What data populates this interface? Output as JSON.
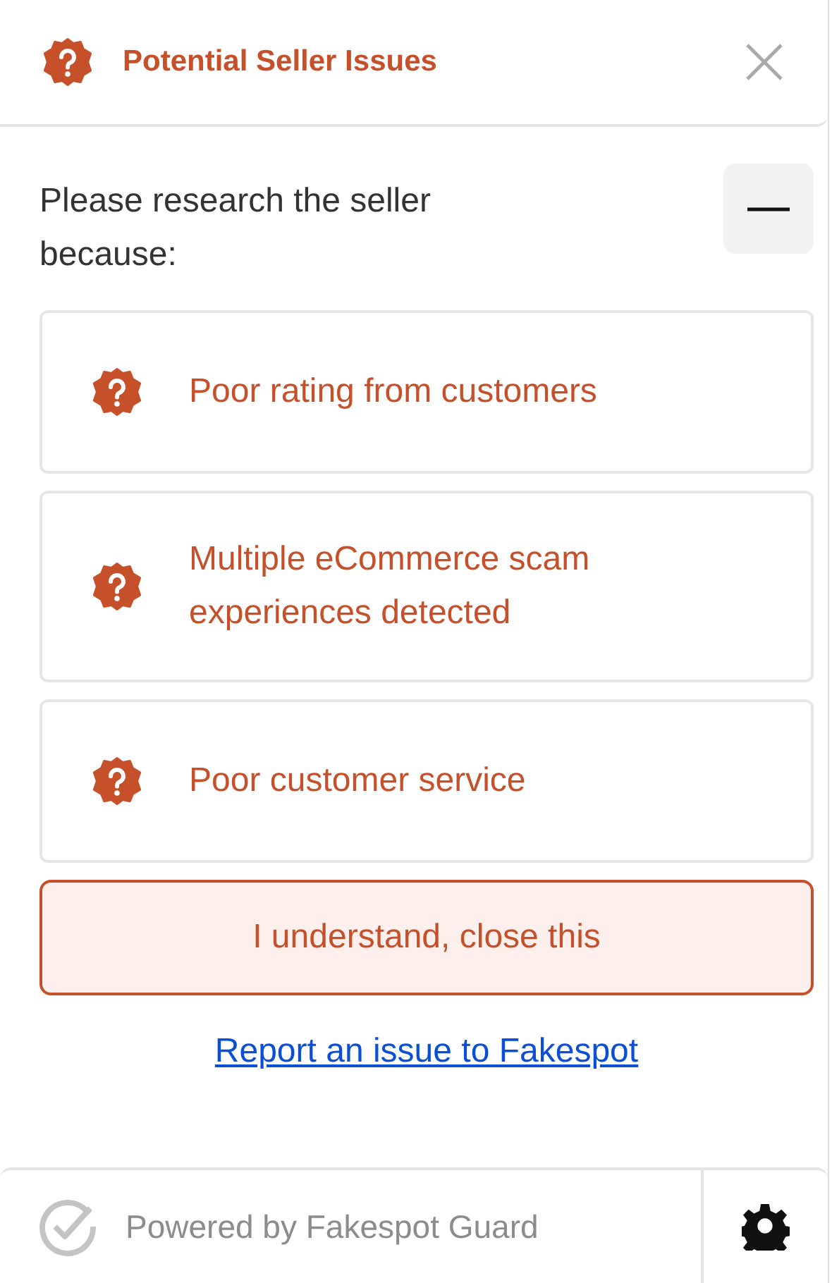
{
  "header": {
    "title": "Potential Seller Issues"
  },
  "intro": "Please research the seller because:",
  "collapse": {
    "expanded": true
  },
  "issues": [
    {
      "text": "Poor rating from customers"
    },
    {
      "text": "Multiple eCommerce scam experiences detected"
    },
    {
      "text": "Poor customer service"
    }
  ],
  "dismiss_button": "I understand, close this",
  "report_link": "Report an issue to Fakespot",
  "footer": {
    "powered_by": "Powered by Fakespot Guard"
  }
}
